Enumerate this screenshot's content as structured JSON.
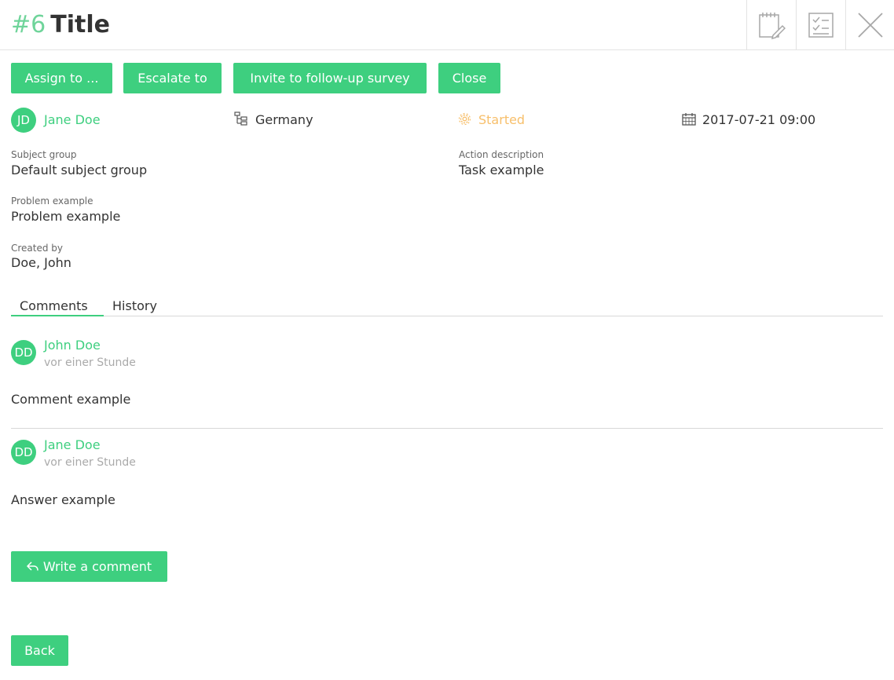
{
  "header": {
    "number": "#6",
    "title": "Title"
  },
  "actions": {
    "assign_label": "Assign to ...",
    "escalate_label": "Escalate to",
    "invite_label": "Invite to follow-up survey",
    "close_label": "Close"
  },
  "meta": {
    "assignee_initials": "JD",
    "assignee_name": "Jane Doe",
    "location": "Germany",
    "status": "Started",
    "datetime": "2017-07-21 09:00"
  },
  "fields": {
    "subject_group_label": "Subject group",
    "subject_group_value": "Default subject group",
    "action_description_label": "Action description",
    "action_description_value": "Task example",
    "problem_label": "Problem example",
    "problem_value": "Problem example",
    "created_by_label": "Created by",
    "created_by_value": "Doe, John"
  },
  "tabs": [
    {
      "label": "Comments",
      "active": true
    },
    {
      "label": "History",
      "active": false
    }
  ],
  "comments": [
    {
      "initials": "DD",
      "author": "John Doe",
      "time": "vor einer Stunde",
      "text": "Comment example"
    },
    {
      "initials": "DD",
      "author": "Jane Doe",
      "time": "vor einer Stunde",
      "text": "Answer example"
    }
  ],
  "footer": {
    "write_comment_label": "Write a comment",
    "back_label": "Back"
  },
  "colors": {
    "accent": "#3ecf7f",
    "status_started": "#f7bf6b",
    "number": "#6fd49a"
  },
  "icons": [
    "notepad-edit-icon",
    "checklist-icon",
    "close-icon",
    "hierarchy-icon",
    "gear-icon",
    "calendar-icon",
    "reply-icon"
  ]
}
